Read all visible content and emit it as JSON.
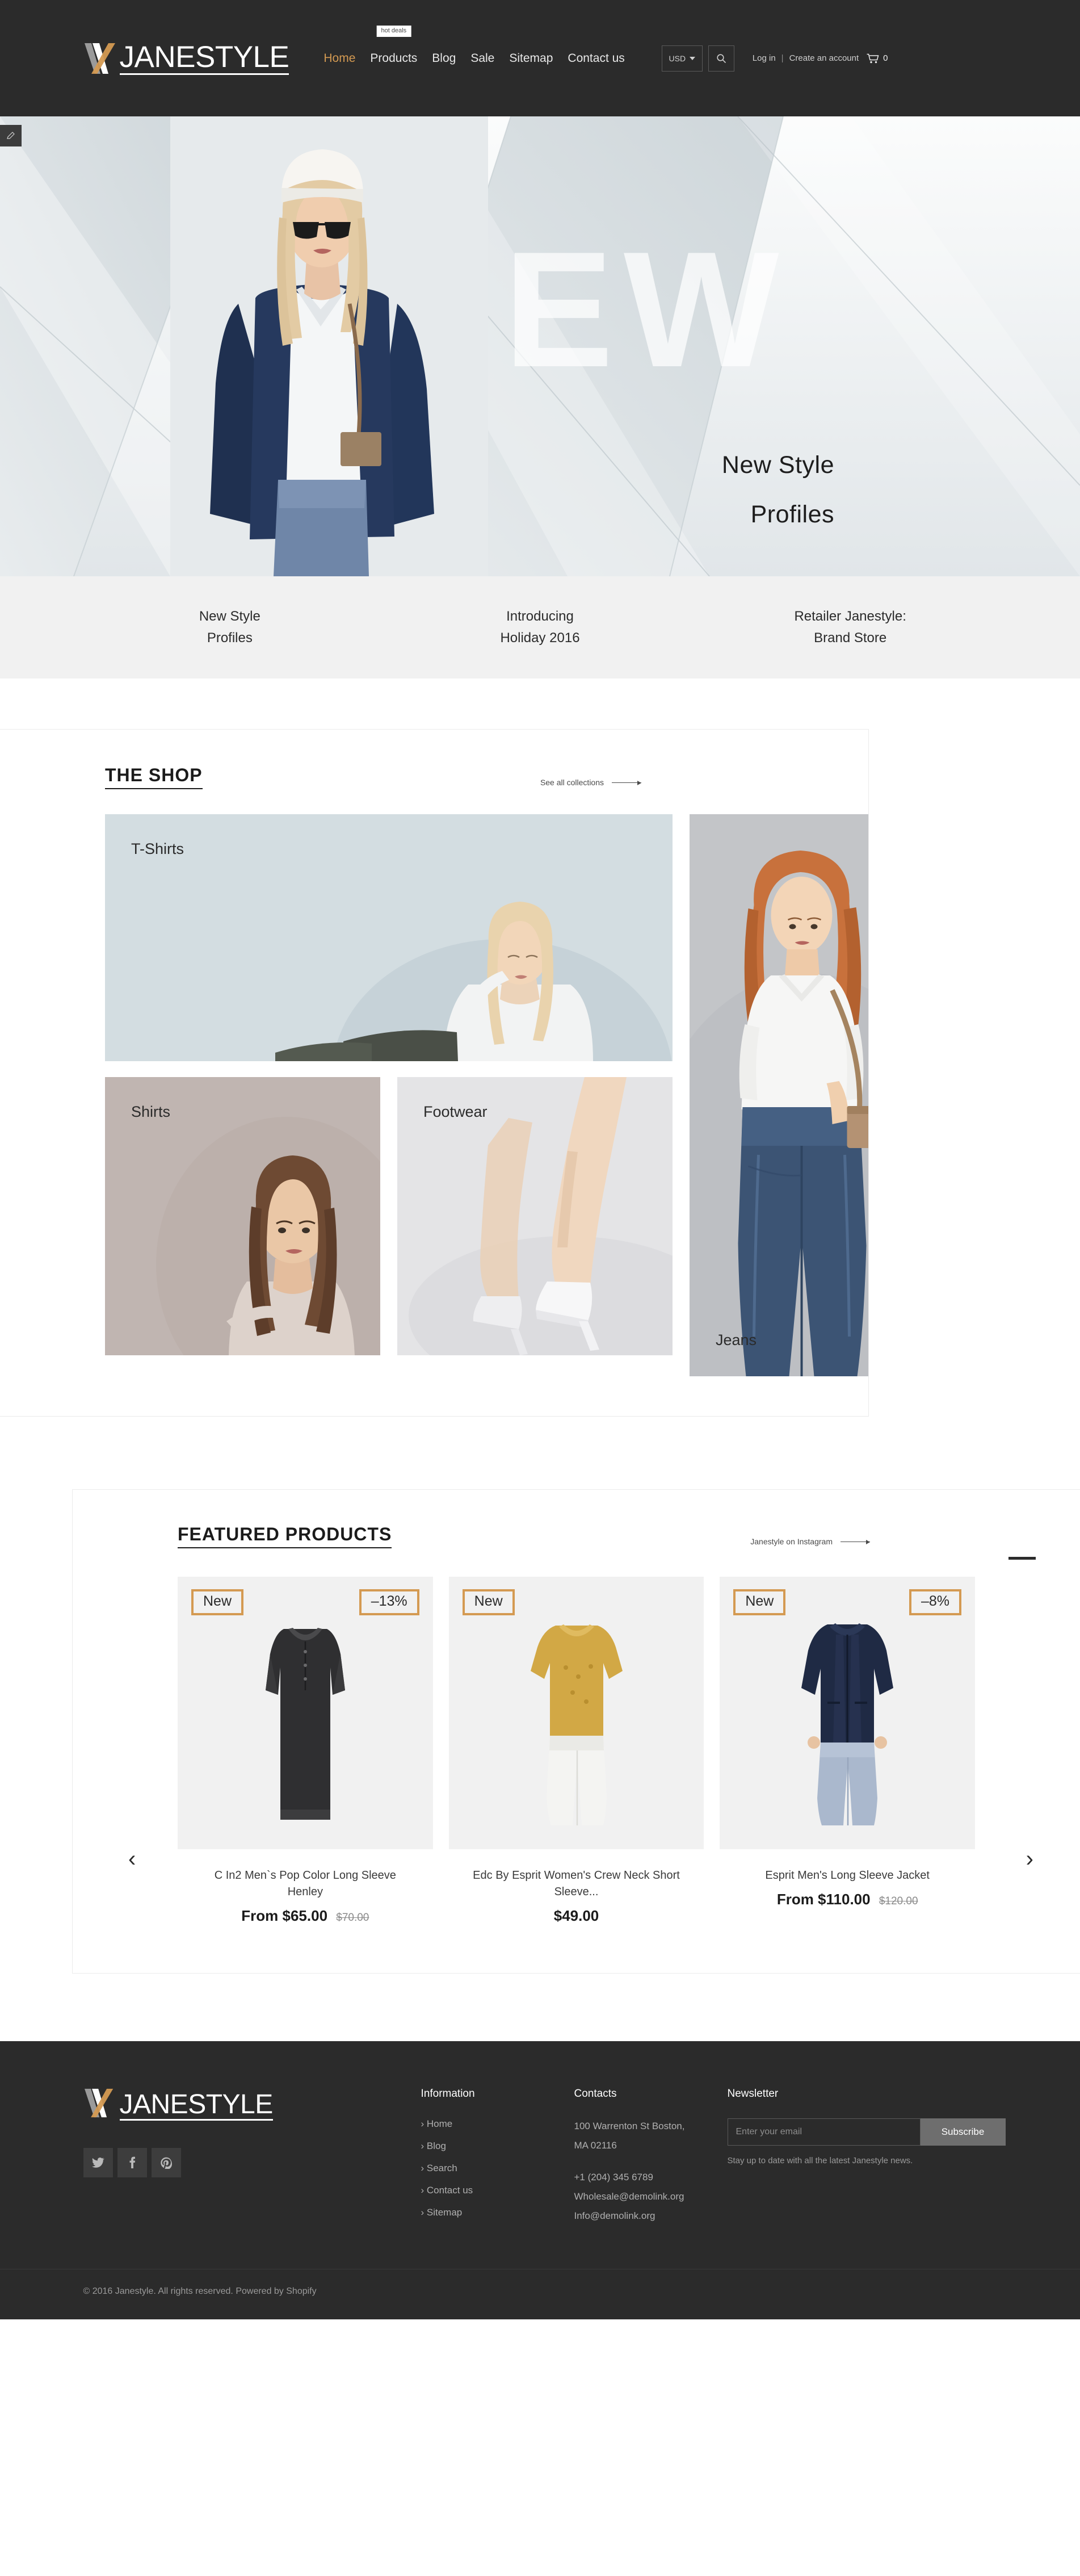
{
  "brand": {
    "name": "JANESTYLE",
    "accent_color": "#d49a52",
    "dark_color": "#2b2b2b"
  },
  "header": {
    "nav": [
      {
        "label": "Home",
        "active": true,
        "badge": null
      },
      {
        "label": "Products",
        "active": false,
        "badge": "hot deals"
      },
      {
        "label": "Blog",
        "active": false,
        "badge": null
      },
      {
        "label": "Sale",
        "active": false,
        "badge": null
      },
      {
        "label": "Sitemap",
        "active": false,
        "badge": null
      },
      {
        "label": "Contact us",
        "active": false,
        "badge": null
      }
    ],
    "currency": "USD",
    "search_icon": "search-icon",
    "login_label": "Log in",
    "separator": "|",
    "create_account_label": "Create an account",
    "cart_icon": "cart-icon",
    "cart_count": "0"
  },
  "hero": {
    "watermark": "NEW",
    "headline_line1": "New Style",
    "headline_line2": "Profiles",
    "tabs": [
      {
        "line1": "New Style",
        "line2": "Profiles"
      },
      {
        "line1": "Introducing",
        "line2": "Holiday 2016"
      },
      {
        "line1": "Retailer Janestyle:",
        "line2": "Brand Store"
      }
    ]
  },
  "shop": {
    "title": "THE SHOP",
    "link_label": "See all collections",
    "collections": [
      {
        "label": "T-Shirts"
      },
      {
        "label": "Shirts"
      },
      {
        "label": "Footwear"
      },
      {
        "label": "Jeans"
      }
    ]
  },
  "featured": {
    "title": "FEATURED PRODUCTS",
    "link_label": "Janestyle on Instagram",
    "prev_arrow": "‹",
    "next_arrow": "›",
    "products": [
      {
        "badge_new": "New",
        "badge_discount": "–13%",
        "title": "C In2 Men`s Pop Color Long Sleeve Henley",
        "price": "From $65.00",
        "price_old": "$70.00"
      },
      {
        "badge_new": "New",
        "badge_discount": null,
        "title": "Edc By Esprit Women's Crew Neck Short Sleeve...",
        "price": "$49.00",
        "price_old": null
      },
      {
        "badge_new": "New",
        "badge_discount": "–8%",
        "title": "Esprit Men's Long Sleeve Jacket",
        "price": "From $110.00",
        "price_old": "$120.00"
      }
    ]
  },
  "footer": {
    "socials": [
      {
        "name": "twitter-icon",
        "glyph": "t"
      },
      {
        "name": "facebook-icon",
        "glyph": "f"
      },
      {
        "name": "pinterest-icon",
        "glyph": "p"
      }
    ],
    "information": {
      "title": "Information",
      "items": [
        "Home",
        "Blog",
        "Search",
        "Contact us",
        "Sitemap"
      ]
    },
    "contacts": {
      "title": "Contacts",
      "address_line1": "100 Warrenton St Boston,",
      "address_line2": "MA 02116",
      "phone": "+1 (204) 345 6789",
      "email_wholesale": "Wholesale@demolink.org",
      "email_info": "Info@demolink.org"
    },
    "newsletter": {
      "title": "Newsletter",
      "placeholder": "Enter your email",
      "value": "",
      "button_label": "Subscribe",
      "note": "Stay up to date with all the latest Janestyle news."
    },
    "copyright": "© 2016 Janestyle. All rights reserved. Powered by Shopify"
  }
}
